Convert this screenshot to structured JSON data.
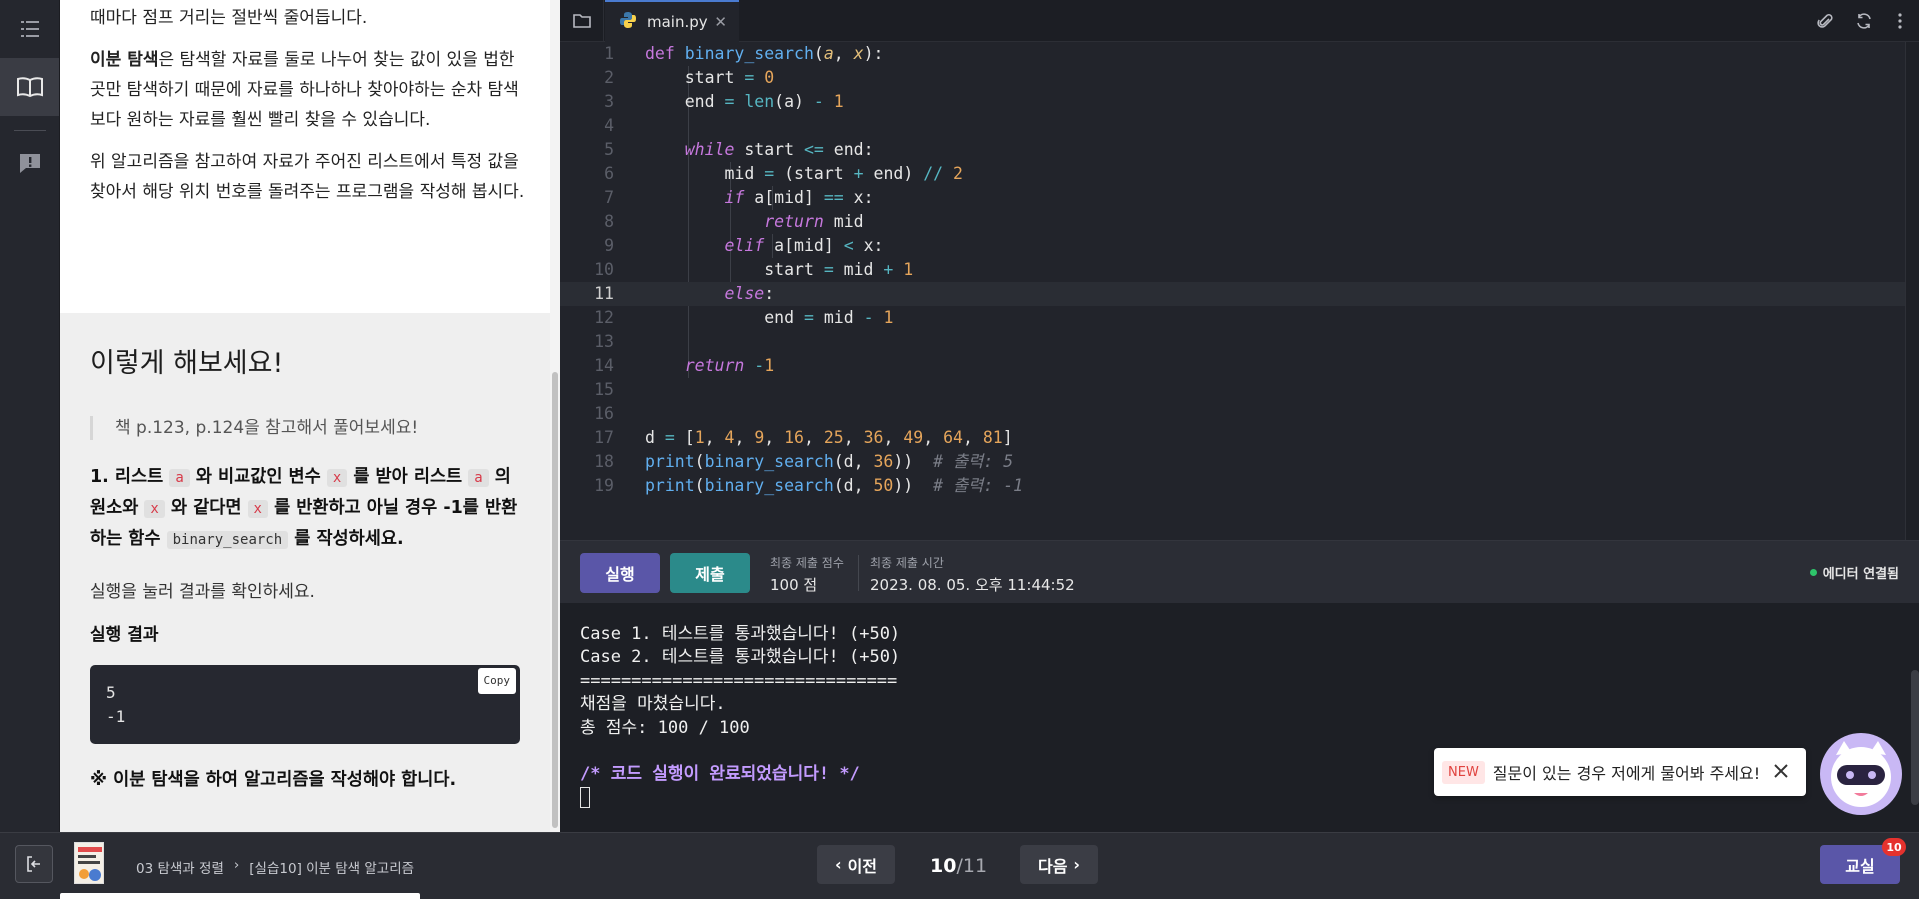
{
  "content": {
    "top_paragraphs": [
      "때마다 점프 거리는 절반씩 줄어듭니다.",
      "은 탐색할 자료를 둘로 나누어 찾는 값이 있을 법한 곳만 탐색하기 때문에 자료를 하나하나 찾아야하는 순차 탐색보다 원하는 자료를 훨씬 빨리 찾을 수 있습니다.",
      "위 알고리즘을 참고하여 자료가 주어진 리스트에서 특정 값을 찾아서 해당 위치 번호를 돌려주는 프로그램을 작성해 봅시다."
    ],
    "bold_term": "이분 탐색",
    "try_title": "이렇게 해보세요!",
    "quote": "책 p.123, p.124을 참고해서 풀어보세요!",
    "task": {
      "prefix": "1. 리스트",
      "var_a": "a",
      "t1": "와 비교값인 변수",
      "var_x": "x",
      "t2": "를 받아 리스트",
      "t3": "의 원소와",
      "t4": "와 같다면",
      "t5": "를 반환하고 아닐 경우 -1를 반환하는 함수",
      "fn_name": "binary_search",
      "t6": "를 작성하세요."
    },
    "run_hint": "실행을 눌러 결과를 확인하세요.",
    "result_heading": "실행 결과",
    "copy_label": "Copy",
    "output_lines": [
      "5",
      "-1"
    ],
    "note": "※ 이분 탐색을 하여 알고리즘을 작성해야 합니다."
  },
  "editor": {
    "tab_name": "main.py",
    "current_line": 11
  },
  "actions": {
    "run_label": "실행",
    "submit_label": "제출",
    "score_label": "최종 제출 점수",
    "score_value": "100 점",
    "time_label": "최종 제출 시간",
    "time_value": "2023. 08. 05. 오후 11:44:52",
    "status": "에디터 연결됨"
  },
  "console": {
    "lines": [
      "Case 1. 테스트를 통과했습니다! (+50)",
      "Case 2. 테스트를 통과했습니다! (+50)",
      "===============================",
      "채점을 마쳤습니다.",
      "총 점수: 100 / 100"
    ],
    "done": "/* 코드 실행이 완료되었습니다! */"
  },
  "chatbot": {
    "new_tag": "NEW",
    "message": "질문이 있는 경우 저에게 물어봐 주세요!"
  },
  "footer": {
    "crumb_chapter": "03 탐색과 정렬",
    "crumb_lesson": "[실습10] 이분 탐색 알고리즘",
    "prev_label": "이전",
    "next_label": "다음",
    "page_current": "10",
    "page_total": "/11",
    "classroom_label": "교실",
    "badge_count": "10"
  },
  "colors": {
    "accent": "#5a56a8",
    "submit": "#2b8a8a",
    "status_ok": "#2ec46a",
    "badge": "#e5322e"
  }
}
